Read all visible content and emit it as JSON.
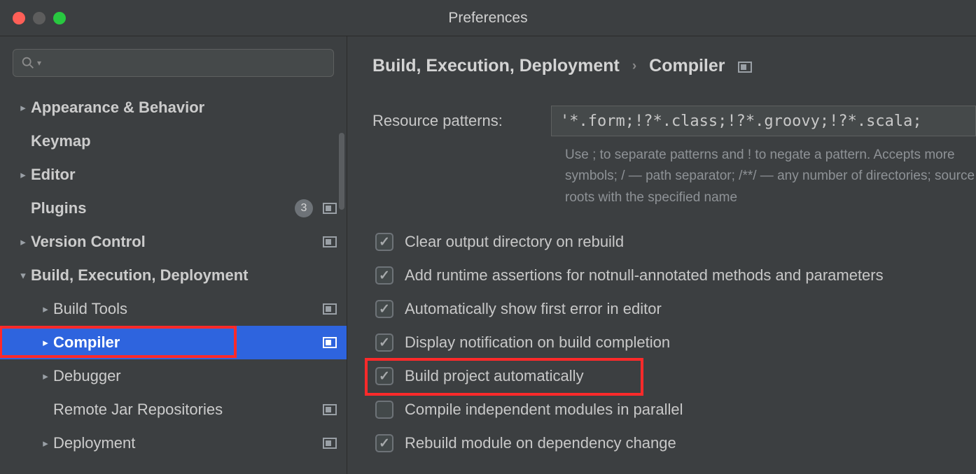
{
  "window": {
    "title": "Preferences"
  },
  "sidebar": {
    "items": [
      {
        "label": "Appearance & Behavior",
        "depth": 0,
        "chevron": "right",
        "bold": true
      },
      {
        "label": "Keymap",
        "depth": 0,
        "chevron": "",
        "bold": true
      },
      {
        "label": "Editor",
        "depth": 0,
        "chevron": "right",
        "bold": true
      },
      {
        "label": "Plugins",
        "depth": 0,
        "chevron": "",
        "bold": true,
        "badge": "3",
        "projicon": true
      },
      {
        "label": "Version Control",
        "depth": 0,
        "chevron": "right",
        "bold": true,
        "projicon": true
      },
      {
        "label": "Build, Execution, Deployment",
        "depth": 0,
        "chevron": "down",
        "bold": true
      },
      {
        "label": "Build Tools",
        "depth": 1,
        "chevron": "right",
        "projicon": true
      },
      {
        "label": "Compiler",
        "depth": 1,
        "chevron": "right",
        "selected": true,
        "projicon": true,
        "highlight": true
      },
      {
        "label": "Debugger",
        "depth": 1,
        "chevron": "right"
      },
      {
        "label": "Remote Jar Repositories",
        "depth": 1,
        "chevron": "",
        "projicon": true
      },
      {
        "label": "Deployment",
        "depth": 1,
        "chevron": "right",
        "projicon": true
      }
    ]
  },
  "breadcrumb": {
    "parent": "Build, Execution, Deployment",
    "sep": "›",
    "current": "Compiler"
  },
  "form": {
    "resource_patterns_label": "Resource patterns:",
    "resource_patterns_value": "'*.form;!?*.class;!?*.groovy;!?*.scala;",
    "hint": "Use ; to separate patterns and ! to negate a pattern. Accepts more symbols; / — path separator; /**/ — any number of directories; source roots with the specified name"
  },
  "checks": [
    {
      "label": "Clear output directory on rebuild",
      "checked": true
    },
    {
      "label": "Add runtime assertions for notnull-annotated methods and parameters",
      "checked": true
    },
    {
      "label": "Automatically show first error in editor",
      "checked": true
    },
    {
      "label": "Display notification on build completion",
      "checked": true
    },
    {
      "label": "Build project automatically",
      "checked": true,
      "highlight": true
    },
    {
      "label": "Compile independent modules in parallel",
      "checked": false
    },
    {
      "label": "Rebuild module on dependency change",
      "checked": true
    }
  ]
}
